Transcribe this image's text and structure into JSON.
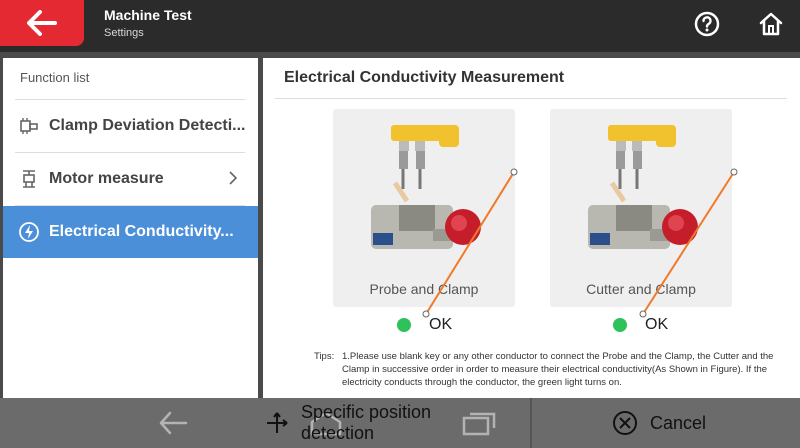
{
  "header": {
    "title": "Machine Test",
    "subtitle": "Settings",
    "back_icon": "arrow-left-icon",
    "help_icon": "question-circle-icon",
    "home_icon": "home-icon"
  },
  "function_list": {
    "header": "Function list",
    "items": [
      {
        "label": "Clamp Deviation Detecti...",
        "icon": "clamp-icon",
        "active": false
      },
      {
        "label": "Motor measure",
        "icon": "motor-icon",
        "active": false,
        "chevron": true
      },
      {
        "label": "Electrical Conductivity...",
        "icon": "lightning-icon",
        "active": true
      }
    ]
  },
  "main": {
    "title": "Electrical Conductivity Measurement",
    "figures": [
      {
        "caption": "Probe and Clamp",
        "status": "OK",
        "status_color": "#2fc25b"
      },
      {
        "caption": "Cutter and Clamp",
        "status": "OK",
        "status_color": "#2fc25b"
      }
    ],
    "tips_label": "Tips:",
    "tips_text": "1.Please use blank key or any other conductor to connect the Probe and the Clamp, the Cutter and the Clamp in successive order in order to measure their electrical conductivity(As Shown in Figure). If the electricity conducts through the conductor, the green light turns on."
  },
  "bottom": {
    "specific_label": "Specific position detection",
    "cancel_label": "Cancel"
  },
  "colors": {
    "accent": "#e42932",
    "active": "#4b8fd9",
    "ok_green": "#2fc25b",
    "wire": "#f07a2a"
  }
}
